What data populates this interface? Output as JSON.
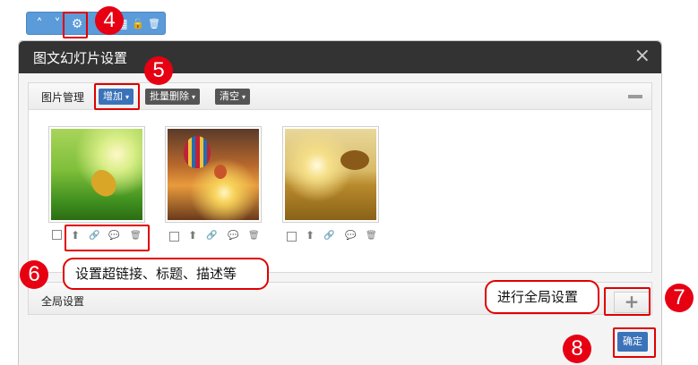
{
  "toolbar": {
    "icons": [
      "chevron-up-icon",
      "chevron-down-icon",
      "gear-icon",
      "grid-icon",
      "unlock-icon",
      "trash-icon"
    ],
    "glyphs": [
      "˄",
      "˅",
      "⚙",
      "▦",
      "🔓",
      "🗑"
    ]
  },
  "dialog": {
    "title": "图文幻灯片设置",
    "close": "×"
  },
  "image_manager": {
    "label": "图片管理",
    "buttons": [
      {
        "label": "增加",
        "arrow": "▾"
      },
      {
        "label": "批量删除",
        "arrow": "▾"
      },
      {
        "label": "清空",
        "arrow": "▾"
      }
    ],
    "images": [
      {
        "alt": "leaf on grass",
        "colors": [
          "#a8d45a",
          "#2c6d14"
        ]
      },
      {
        "alt": "hot air balloons at sunset",
        "colors": [
          "#b8682c",
          "#6b3a1c"
        ]
      },
      {
        "alt": "tree in golden field",
        "colors": [
          "#d8bb6a",
          "#8a6218"
        ]
      }
    ],
    "image_action_icons": [
      "checkbox",
      "upload-icon",
      "link-icon",
      "comment-icon",
      "trash-icon"
    ],
    "image_action_glyphs": [
      "",
      "⬆",
      "🔗",
      "💬",
      "🗑"
    ]
  },
  "global_settings": {
    "label": "全局设置",
    "expand": "+"
  },
  "ok_button": "确定",
  "annotations": {
    "badges": [
      "4",
      "5",
      "6",
      "7",
      "8"
    ],
    "callout_links": "设置超链接、标题、描述等",
    "callout_global": "进行全局设置"
  },
  "colors": {
    "title_bar": "#333333",
    "primary_button": "#3a73b9",
    "annotation": "#e00000",
    "toolbar": "#5b9bd9"
  }
}
